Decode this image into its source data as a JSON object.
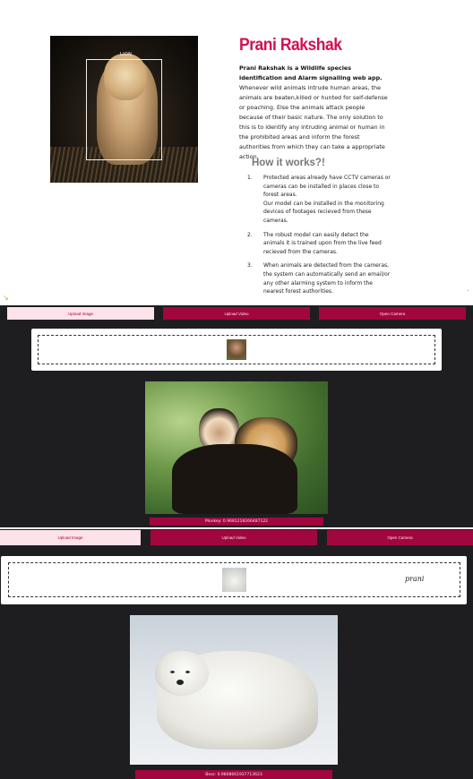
{
  "hero": {
    "image_label": "LION",
    "title": "Prani Rakshak",
    "intro_bold": "Prani Rakshak is a Wildlife species identification and Alarm signalling web app.",
    "intro": "Whenever wild animals intrude human areas, the animals are beaten,killed or hunted for self-defense or poaching. Else the animals attack people because of their basic nature. The only solution to this is to identify any intruding animal or human in the prohibited areas and inform the forest authorities from which they can take a appropriate action.",
    "how_title": "How it works?!",
    "steps": [
      {
        "num": "1.",
        "text": "Protected areas already have CCTV cameras or cameras can be installed in places close to forest areas.\nOur model can be installed in the monitoring devices of footages recieved from these cameras."
      },
      {
        "num": "2.",
        "text": "The robust model can easily detect the animals it is trained upon from the live feed recieved from the cameras."
      },
      {
        "num": "3.",
        "text": "When animals are detected from the cameras, the system can automatically send an email/or any other alarming system to inform the nearest forest authorities."
      }
    ]
  },
  "session1": {
    "upload_image": "Upload Image",
    "upload_video": "Upload Video",
    "open_camera": "Open Camera",
    "result_label": "Monkey: 0.9681218266487122"
  },
  "session2": {
    "upload_image": "Upload Image",
    "upload_video": "Upload Video",
    "open_camera": "Open Camera",
    "note": "prani",
    "result_label": "Bear: 0.9808661937713623"
  },
  "colors": {
    "accent": "#a2063f",
    "title": "#d1114f",
    "active_tab_bg": "#fde2ea",
    "page_bg": "#1e1e21"
  },
  "icons": {
    "corner": "cursor-icon"
  }
}
